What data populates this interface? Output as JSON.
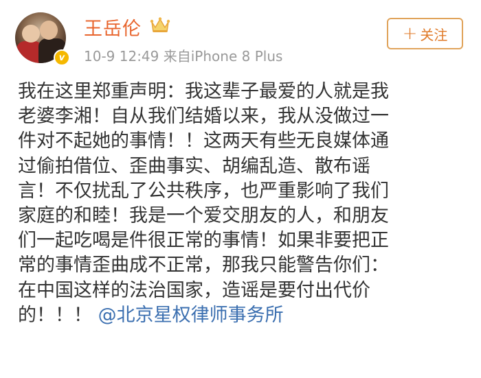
{
  "header": {
    "username": "王岳伦",
    "timestamp": "10-9 12:49",
    "source": "来自iPhone 8 Plus",
    "follow_label": "关注"
  },
  "post": {
    "lines": [
      "我在这里郑重声明：我这辈子最爱的人就是我",
      "老婆李湘！自从我们结婚以来，我从没做过一",
      "件对不起她的事情！！这两天有些无良媒体通",
      "过偷拍借位、歪曲事实、胡编乱造、散布谣",
      "言！不仅扰乱了公共秩序，也严重影响了我们",
      "家庭的和睦！我是一个爱交朋友的人，和朋友",
      "们一起吃喝是件很正常的事情！如果非要把正",
      "常的事情歪曲成不正常，那我只能警告你们：",
      "在中国这样的法治国家，造谣是要付出代价"
    ],
    "last_line_prefix": "的！！！",
    "mention": "@北京星权律师事务所"
  },
  "icons": {
    "crown": "crown-icon",
    "verified": "verified-v-icon",
    "plus": "plus-icon"
  },
  "colors": {
    "username": "#e8642c",
    "follow": "#e07b2a",
    "mention": "#3b6fb0",
    "meta": "#999999",
    "verified": "#f5b800"
  }
}
